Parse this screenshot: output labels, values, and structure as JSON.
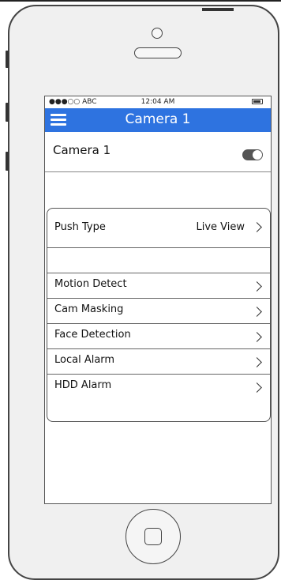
{
  "status_bar": {
    "carrier": "●●●○○ ABC",
    "time": "12:04 AM"
  },
  "nav": {
    "title": "Camera 1"
  },
  "camera_toggle": {
    "label": "Camera 1",
    "on": true
  },
  "settings": {
    "push_type": {
      "label": "Push Type",
      "value": "Live View"
    },
    "items": [
      {
        "label": "Motion Detect"
      },
      {
        "label": "Cam Masking"
      },
      {
        "label": "Face Detection"
      },
      {
        "label": "Local Alarm"
      },
      {
        "label": "HDD Alarm"
      }
    ]
  },
  "colors": {
    "nav_bar": "#2e73e0",
    "toggle": "#555555"
  },
  "icons": {
    "menu": "hamburger-icon",
    "chevron": "chevron-right-icon",
    "home": "home-button-icon"
  }
}
